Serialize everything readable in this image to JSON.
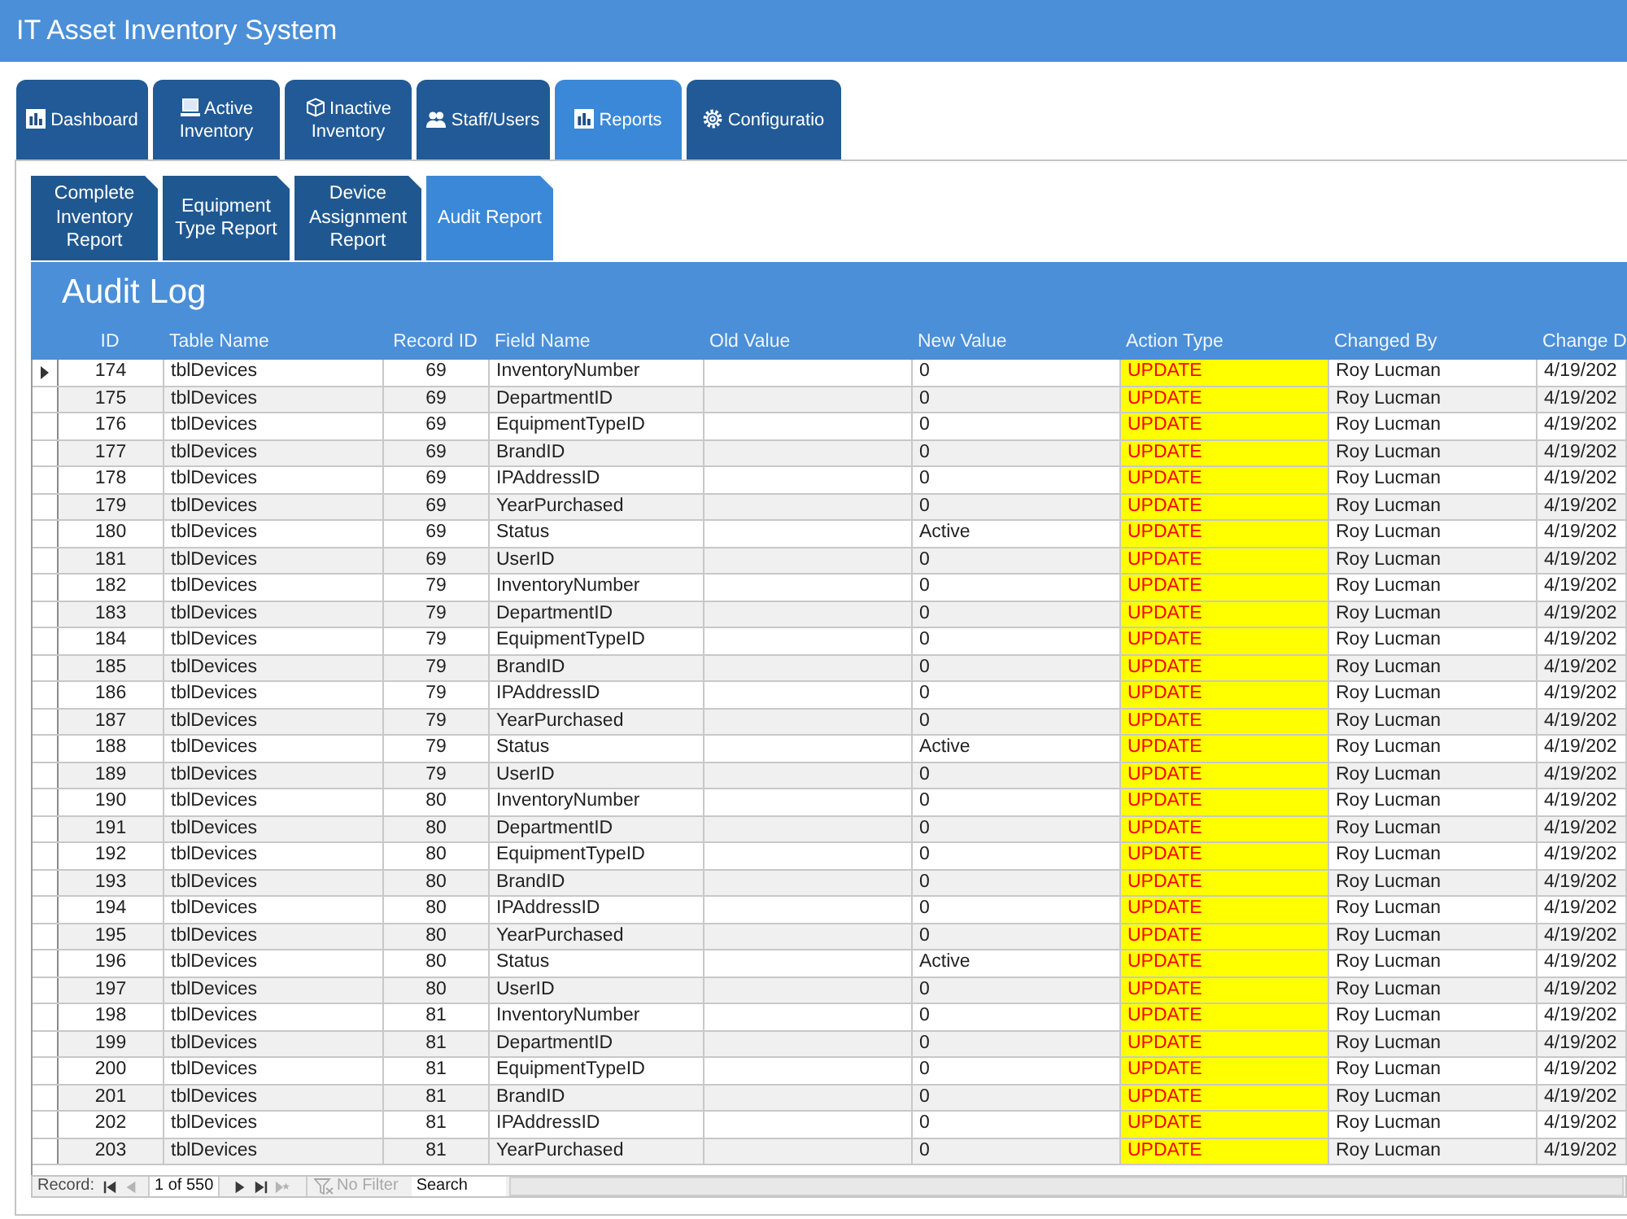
{
  "window": {
    "title": "IT Asset Inventory System"
  },
  "tabs": [
    {
      "label": "Dashboard",
      "selected": false
    },
    {
      "label": "Active Inventory",
      "selected": false
    },
    {
      "label": "Inactive Inventory",
      "selected": false
    },
    {
      "label": "Staff/Users",
      "selected": false
    },
    {
      "label": "Reports",
      "selected": true
    },
    {
      "label": "Configuratio",
      "selected": false
    }
  ],
  "subtabs": [
    {
      "label": "Complete Inventory Report",
      "selected": false
    },
    {
      "label": "Equipment Type Report",
      "selected": false
    },
    {
      "label": "Device Assignment Report",
      "selected": false
    },
    {
      "label": "Audit Report",
      "selected": true
    }
  ],
  "form": {
    "title": "Audit Log"
  },
  "table": {
    "columns": [
      "ID",
      "Table Name",
      "Record ID",
      "Field Name",
      "Old Value",
      "New Value",
      "Action Type",
      "Changed By",
      "Change D"
    ],
    "rows": [
      {
        "selected": true,
        "id": "174",
        "table_name": "tblDevices",
        "record_id": "69",
        "field_name": "InventoryNumber",
        "new_value": "0",
        "action_type": "UPDATE",
        "changed_by": "Roy Lucman",
        "change_date": "4/19/202"
      },
      {
        "selected": false,
        "id": "175",
        "table_name": "tblDevices",
        "record_id": "69",
        "field_name": "DepartmentID",
        "new_value": "0",
        "action_type": "UPDATE",
        "changed_by": "Roy Lucman",
        "change_date": "4/19/202"
      },
      {
        "selected": false,
        "id": "176",
        "table_name": "tblDevices",
        "record_id": "69",
        "field_name": "EquipmentTypeID",
        "new_value": "0",
        "action_type": "UPDATE",
        "changed_by": "Roy Lucman",
        "change_date": "4/19/202"
      },
      {
        "selected": false,
        "id": "177",
        "table_name": "tblDevices",
        "record_id": "69",
        "field_name": "BrandID",
        "new_value": "0",
        "action_type": "UPDATE",
        "changed_by": "Roy Lucman",
        "change_date": "4/19/202"
      },
      {
        "selected": false,
        "id": "178",
        "table_name": "tblDevices",
        "record_id": "69",
        "field_name": "IPAddressID",
        "new_value": "0",
        "action_type": "UPDATE",
        "changed_by": "Roy Lucman",
        "change_date": "4/19/202"
      },
      {
        "selected": false,
        "id": "179",
        "table_name": "tblDevices",
        "record_id": "69",
        "field_name": "YearPurchased",
        "new_value": "0",
        "action_type": "UPDATE",
        "changed_by": "Roy Lucman",
        "change_date": "4/19/202"
      },
      {
        "selected": false,
        "id": "180",
        "table_name": "tblDevices",
        "record_id": "69",
        "field_name": "Status",
        "new_value": "Active",
        "action_type": "UPDATE",
        "changed_by": "Roy Lucman",
        "change_date": "4/19/202"
      },
      {
        "selected": false,
        "id": "181",
        "table_name": "tblDevices",
        "record_id": "69",
        "field_name": "UserID",
        "new_value": "0",
        "action_type": "UPDATE",
        "changed_by": "Roy Lucman",
        "change_date": "4/19/202"
      },
      {
        "selected": false,
        "id": "182",
        "table_name": "tblDevices",
        "record_id": "79",
        "field_name": "InventoryNumber",
        "new_value": "0",
        "action_type": "UPDATE",
        "changed_by": "Roy Lucman",
        "change_date": "4/19/202"
      },
      {
        "selected": false,
        "id": "183",
        "table_name": "tblDevices",
        "record_id": "79",
        "field_name": "DepartmentID",
        "new_value": "0",
        "action_type": "UPDATE",
        "changed_by": "Roy Lucman",
        "change_date": "4/19/202"
      },
      {
        "selected": false,
        "id": "184",
        "table_name": "tblDevices",
        "record_id": "79",
        "field_name": "EquipmentTypeID",
        "new_value": "0",
        "action_type": "UPDATE",
        "changed_by": "Roy Lucman",
        "change_date": "4/19/202"
      },
      {
        "selected": false,
        "id": "185",
        "table_name": "tblDevices",
        "record_id": "79",
        "field_name": "BrandID",
        "new_value": "0",
        "action_type": "UPDATE",
        "changed_by": "Roy Lucman",
        "change_date": "4/19/202"
      },
      {
        "selected": false,
        "id": "186",
        "table_name": "tblDevices",
        "record_id": "79",
        "field_name": "IPAddressID",
        "new_value": "0",
        "action_type": "UPDATE",
        "changed_by": "Roy Lucman",
        "change_date": "4/19/202"
      },
      {
        "selected": false,
        "id": "187",
        "table_name": "tblDevices",
        "record_id": "79",
        "field_name": "YearPurchased",
        "new_value": "0",
        "action_type": "UPDATE",
        "changed_by": "Roy Lucman",
        "change_date": "4/19/202"
      },
      {
        "selected": false,
        "id": "188",
        "table_name": "tblDevices",
        "record_id": "79",
        "field_name": "Status",
        "new_value": "Active",
        "action_type": "UPDATE",
        "changed_by": "Roy Lucman",
        "change_date": "4/19/202"
      },
      {
        "selected": false,
        "id": "189",
        "table_name": "tblDevices",
        "record_id": "79",
        "field_name": "UserID",
        "new_value": "0",
        "action_type": "UPDATE",
        "changed_by": "Roy Lucman",
        "change_date": "4/19/202"
      },
      {
        "selected": false,
        "id": "190",
        "table_name": "tblDevices",
        "record_id": "80",
        "field_name": "InventoryNumber",
        "new_value": "0",
        "action_type": "UPDATE",
        "changed_by": "Roy Lucman",
        "change_date": "4/19/202"
      },
      {
        "selected": false,
        "id": "191",
        "table_name": "tblDevices",
        "record_id": "80",
        "field_name": "DepartmentID",
        "new_value": "0",
        "action_type": "UPDATE",
        "changed_by": "Roy Lucman",
        "change_date": "4/19/202"
      },
      {
        "selected": false,
        "id": "192",
        "table_name": "tblDevices",
        "record_id": "80",
        "field_name": "EquipmentTypeID",
        "new_value": "0",
        "action_type": "UPDATE",
        "changed_by": "Roy Lucman",
        "change_date": "4/19/202"
      },
      {
        "selected": false,
        "id": "193",
        "table_name": "tblDevices",
        "record_id": "80",
        "field_name": "BrandID",
        "new_value": "0",
        "action_type": "UPDATE",
        "changed_by": "Roy Lucman",
        "change_date": "4/19/202"
      },
      {
        "selected": false,
        "id": "194",
        "table_name": "tblDevices",
        "record_id": "80",
        "field_name": "IPAddressID",
        "new_value": "0",
        "action_type": "UPDATE",
        "changed_by": "Roy Lucman",
        "change_date": "4/19/202"
      },
      {
        "selected": false,
        "id": "195",
        "table_name": "tblDevices",
        "record_id": "80",
        "field_name": "YearPurchased",
        "new_value": "0",
        "action_type": "UPDATE",
        "changed_by": "Roy Lucman",
        "change_date": "4/19/202"
      },
      {
        "selected": false,
        "id": "196",
        "table_name": "tblDevices",
        "record_id": "80",
        "field_name": "Status",
        "new_value": "Active",
        "action_type": "UPDATE",
        "changed_by": "Roy Lucman",
        "change_date": "4/19/202"
      },
      {
        "selected": false,
        "id": "197",
        "table_name": "tblDevices",
        "record_id": "80",
        "field_name": "UserID",
        "new_value": "0",
        "action_type": "UPDATE",
        "changed_by": "Roy Lucman",
        "change_date": "4/19/202"
      },
      {
        "selected": false,
        "id": "198",
        "table_name": "tblDevices",
        "record_id": "81",
        "field_name": "InventoryNumber",
        "new_value": "0",
        "action_type": "UPDATE",
        "changed_by": "Roy Lucman",
        "change_date": "4/19/202"
      },
      {
        "selected": false,
        "id": "199",
        "table_name": "tblDevices",
        "record_id": "81",
        "field_name": "DepartmentID",
        "new_value": "0",
        "action_type": "UPDATE",
        "changed_by": "Roy Lucman",
        "change_date": "4/19/202"
      },
      {
        "selected": false,
        "id": "200",
        "table_name": "tblDevices",
        "record_id": "81",
        "field_name": "EquipmentTypeID",
        "new_value": "0",
        "action_type": "UPDATE",
        "changed_by": "Roy Lucman",
        "change_date": "4/19/202"
      },
      {
        "selected": false,
        "id": "201",
        "table_name": "tblDevices",
        "record_id": "81",
        "field_name": "BrandID",
        "new_value": "0",
        "action_type": "UPDATE",
        "changed_by": "Roy Lucman",
        "change_date": "4/19/202"
      },
      {
        "selected": false,
        "id": "202",
        "table_name": "tblDevices",
        "record_id": "81",
        "field_name": "IPAddressID",
        "new_value": "0",
        "action_type": "UPDATE",
        "changed_by": "Roy Lucman",
        "change_date": "4/19/202"
      },
      {
        "selected": false,
        "id": "203",
        "table_name": "tblDevices",
        "record_id": "81",
        "field_name": "YearPurchased",
        "new_value": "0",
        "action_type": "UPDATE",
        "changed_by": "Roy Lucman",
        "change_date": "4/19/202"
      }
    ]
  },
  "navigation": {
    "label": "Record:",
    "leading_buttons": [
      {
        "kind": "first",
        "disabled": false
      },
      {
        "kind": "previous",
        "disabled": true
      }
    ],
    "position": "1 of 550",
    "trailing_buttons": [
      {
        "kind": "next",
        "disabled": false
      },
      {
        "kind": "last",
        "disabled": false
      },
      {
        "kind": "new",
        "disabled": true
      }
    ],
    "filter": {
      "label": "No Filter",
      "disabled": true
    },
    "search": {
      "placeholder": "Search"
    }
  }
}
